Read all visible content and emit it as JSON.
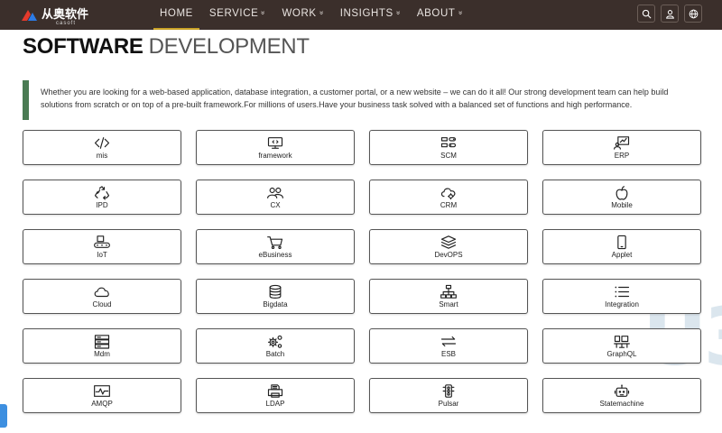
{
  "brand": {
    "name": "从奥软件",
    "sub": "casoft"
  },
  "nav": [
    {
      "label": "HOME",
      "active": true,
      "has_menu": false
    },
    {
      "label": "SERVICE",
      "active": false,
      "has_menu": true
    },
    {
      "label": "WORK",
      "active": false,
      "has_menu": true
    },
    {
      "label": "INSIGHTS",
      "active": false,
      "has_menu": true
    },
    {
      "label": "ABOUT",
      "active": false,
      "has_menu": true
    }
  ],
  "tools": [
    "search-icon",
    "user-icon",
    "globe-icon"
  ],
  "heading": {
    "bold": "SOFTWARE",
    "light": "DEVELOPMENT"
  },
  "intro": "Whether you are looking for a web-based application, database integration, a customer portal, or a new website – we can do it all! Our strong development team can help build solutions from scratch or on top of a pre-built framework.For millions of users.Have your business task solved with a balanced set of functions and high performance.",
  "cards": [
    {
      "label": "mis",
      "icon": "code"
    },
    {
      "label": "framework",
      "icon": "monitor-code"
    },
    {
      "label": "SCM",
      "icon": "list-toggle"
    },
    {
      "label": "ERP",
      "icon": "chart-user"
    },
    {
      "label": "IPD",
      "icon": "recycle"
    },
    {
      "label": "CX",
      "icon": "users"
    },
    {
      "label": "CRM",
      "icon": "cloud-gear"
    },
    {
      "label": "Mobile",
      "icon": "apple"
    },
    {
      "label": "IoT",
      "icon": "conveyor"
    },
    {
      "label": "eBusiness",
      "icon": "cart"
    },
    {
      "label": "DevOPS",
      "icon": "layers"
    },
    {
      "label": "Applet",
      "icon": "phone"
    },
    {
      "label": "Cloud",
      "icon": "cloud"
    },
    {
      "label": "Bigdata",
      "icon": "database"
    },
    {
      "label": "Smart",
      "icon": "network"
    },
    {
      "label": "Integration",
      "icon": "list"
    },
    {
      "label": "Mdm",
      "icon": "server"
    },
    {
      "label": "Batch",
      "icon": "gears"
    },
    {
      "label": "ESB",
      "icon": "exchange"
    },
    {
      "label": "GraphQL",
      "icon": "graph"
    },
    {
      "label": "AMQP",
      "icon": "pulse"
    },
    {
      "label": "LDAP",
      "icon": "printer"
    },
    {
      "label": "Pulsar",
      "icon": "traffic"
    },
    {
      "label": "Statemachine",
      "icon": "robot"
    }
  ],
  "colors": {
    "topbar": "#3b2f2b",
    "active_underline": "#c9a227",
    "intro_bar": "#4a7b53",
    "watermark": "#dbe6ee"
  }
}
